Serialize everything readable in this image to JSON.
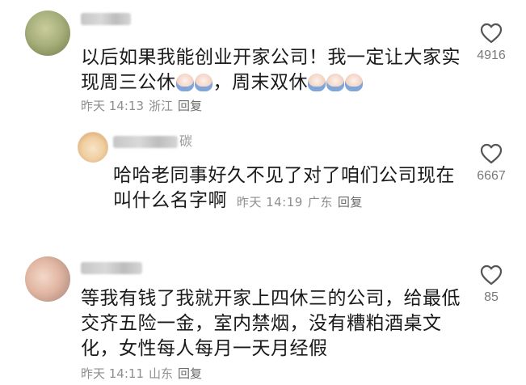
{
  "comments": [
    {
      "text_lines": [
        "以后如果我能创业开家公司！我一定让大家实",
        "现周三公休",
        "，周末双休"
      ],
      "emoji_1": "emoji-faces-icon",
      "emoji_2": "emoji-faces-icon",
      "time": "昨天 14:13",
      "location": "浙江",
      "reply_label": "回复",
      "likes": "4916"
    },
    {
      "is_reply": true,
      "name": "碳",
      "text_lines": [
        "哈哈老同事好久不见了对了咱们公司现在",
        "叫什么名字啊"
      ],
      "time": "昨天 14:19",
      "location": "广东",
      "reply_label": "回复",
      "likes": "6667"
    },
    {
      "text_lines": [
        "等我有钱了我就开家上四休三的公司，给最低",
        "交齐五险一金，室内禁烟，没有糟粕酒桌文",
        "化，女性每人每月一天月经假"
      ],
      "time": "昨天 14:11",
      "location": "山东",
      "reply_label": "回复",
      "likes": "85"
    }
  ],
  "colors": {
    "text": "#1a1a1a",
    "meta": "#8e8e8e",
    "icon": "#555555"
  },
  "icons": {
    "like": "heart-outline-icon"
  }
}
